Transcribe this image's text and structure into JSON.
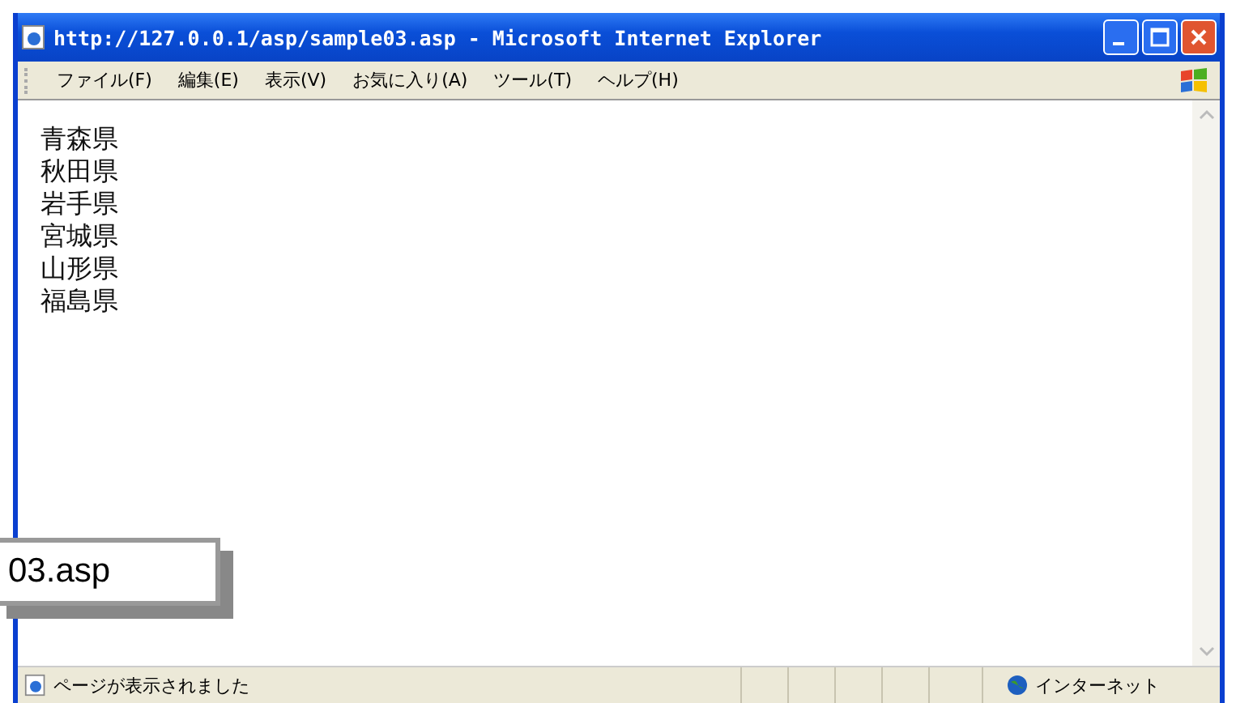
{
  "window": {
    "title": "http://127.0.0.1/asp/sample03.asp - Microsoft Internet Explorer"
  },
  "menu": [
    "ファイル(F)",
    "編集(E)",
    "表示(V)",
    "お気に入り(A)",
    "ツール(T)",
    "ヘルプ(H)"
  ],
  "content": {
    "lines": [
      "青森県",
      "秋田県",
      "岩手県",
      "宮城県",
      "山形県",
      "福島県"
    ]
  },
  "caption": {
    "text": "03.asp"
  },
  "status_bar": {
    "message": "ページが表示されました",
    "zone": "インターネット"
  }
}
